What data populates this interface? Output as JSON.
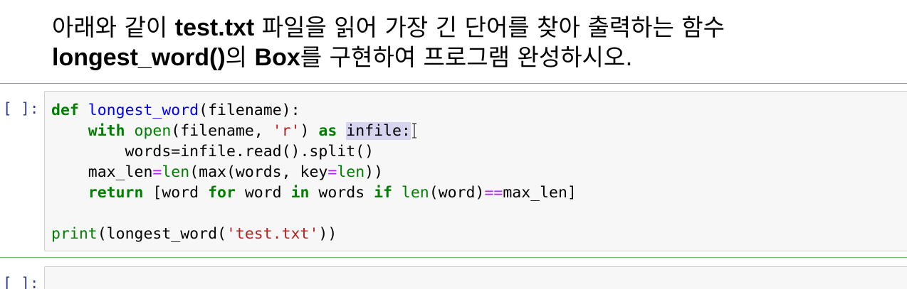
{
  "markdown": {
    "line1_pre": "아래와 같이 ",
    "line1_bold": "test.txt",
    "line1_post": " 파일을 읽어 가장 긴 단어를 찾아 출력하는 함수",
    "line2_bold1": "longest_word()",
    "line2_mid": "의 ",
    "line2_bold2": "Box",
    "line2_post": "를 구현하여 프로그램 완성하시오."
  },
  "cells": [
    {
      "prompt": "[ ]:",
      "code": {
        "l1": {
          "def": "def",
          "fn": "longest_word",
          "rest": "(filename):"
        },
        "l2": {
          "indent": "    ",
          "with": "with",
          "sp1": " ",
          "open": "open",
          "args": "(filename, ",
          "str": "'r'",
          "close": ") ",
          "as": "as",
          "sp2": " ",
          "target": "infile:"
        },
        "l3": {
          "text": "        words=infile.read().split()"
        },
        "l4": {
          "a": "    max_len",
          "eq": "=",
          "len": "len",
          "b": "(max(words, key",
          "eq2": "=",
          "len2": "len",
          "c": "))"
        },
        "l5": {
          "indent": "    ",
          "return": "return",
          "a": " [word ",
          "for": "for",
          "b": " word ",
          "in": "in",
          "c": " words ",
          "if": "if",
          "d": " ",
          "len": "len",
          "e": "(word)",
          "op": "==",
          "f": "max_len]"
        },
        "l7": {
          "print": "print",
          "a": "(longest_word(",
          "str": "'test.txt'",
          "b": "))"
        }
      }
    },
    {
      "prompt": "[ ]:",
      "code": ""
    }
  ],
  "colors": {
    "keyword": "#008000",
    "function_name": "#0000ff",
    "string": "#ba2121",
    "operator": "#aa22ff",
    "prompt": "#303f9f",
    "selected_cell_border": "#66bb6a",
    "selection_highlight": "#d7d4f0"
  },
  "icons": [
    "text-cursor-icon"
  ]
}
